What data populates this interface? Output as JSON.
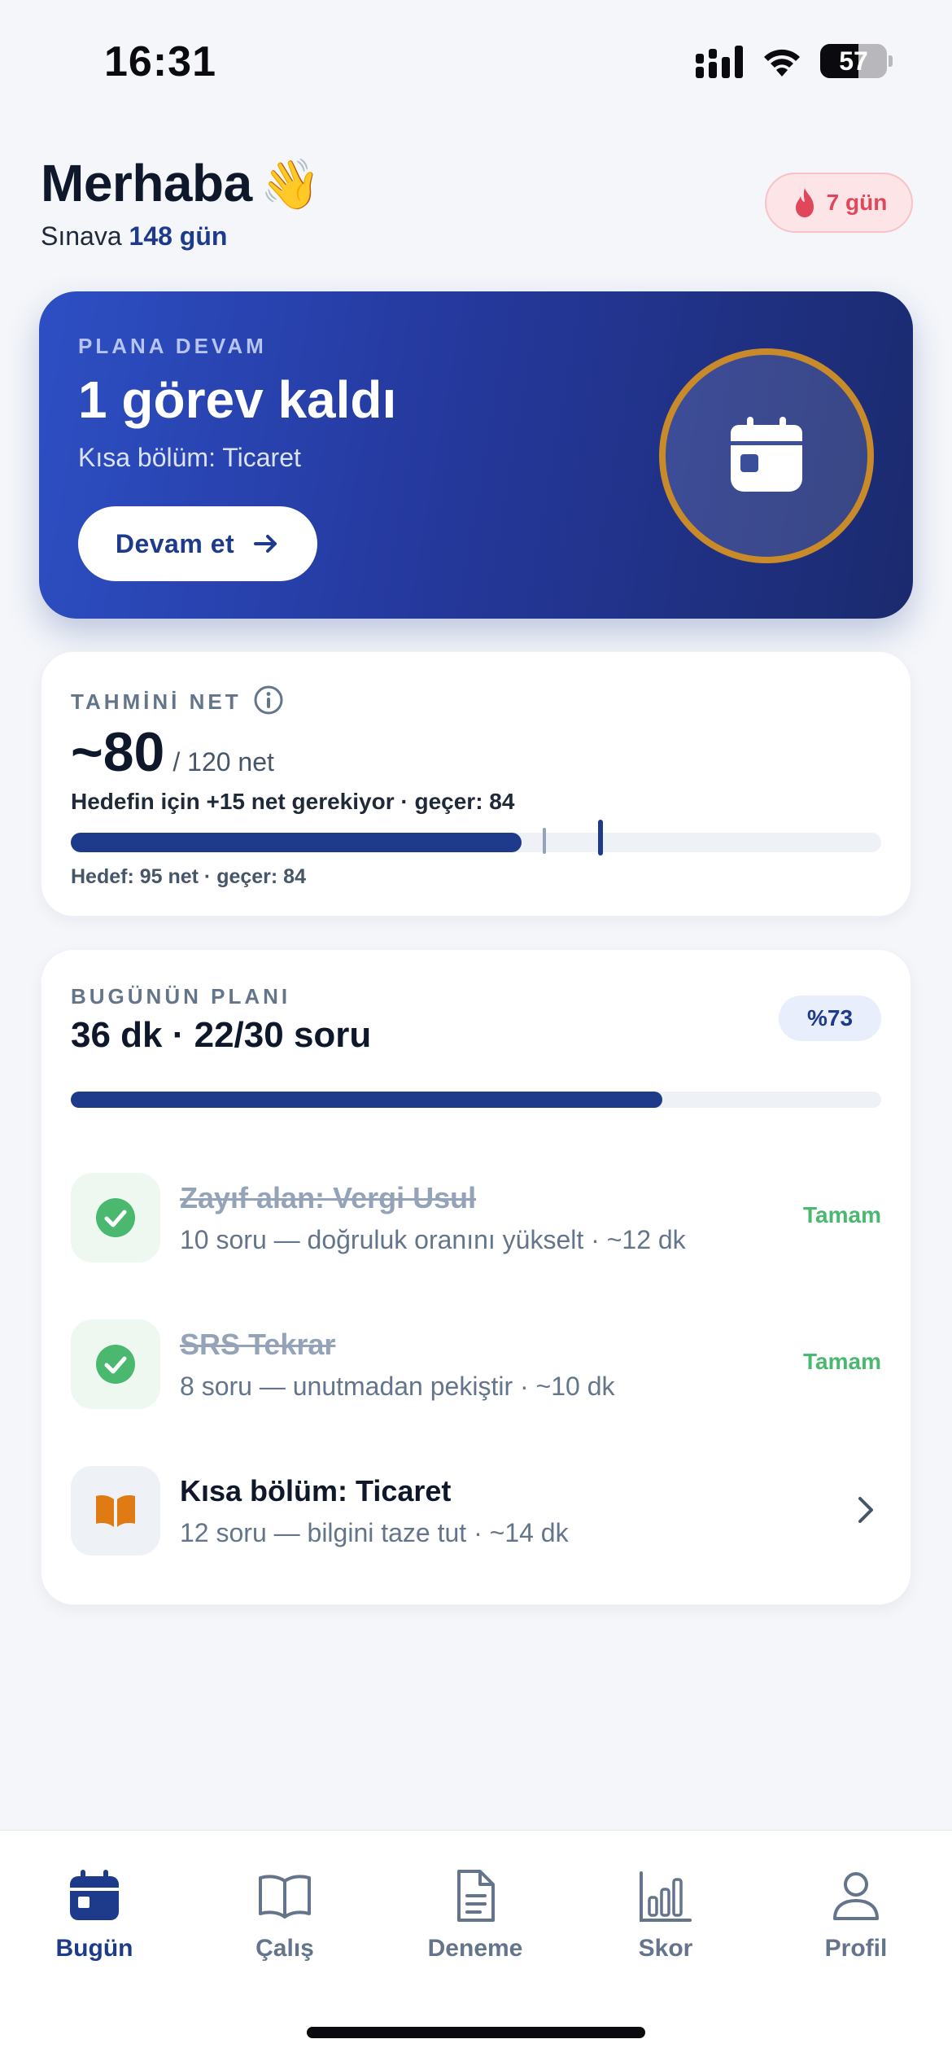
{
  "status_bar": {
    "time": "16:31",
    "battery": "57",
    "battery_level": 0.57
  },
  "header": {
    "greeting": "Merhaba",
    "greeting_emoji": "👋",
    "subtitle_prefix": "Sınava",
    "subtitle_days": "148 gün",
    "streak": "7 gün"
  },
  "hero": {
    "eyebrow": "PLANA DEVAM",
    "title": "1 görev kaldı",
    "subtitle": "Kısa bölüm: Ticaret",
    "button_label": "Devam et",
    "icon": "calendar-icon"
  },
  "net": {
    "eyebrow": "TAHMİNİ NET",
    "value": "~80",
    "total": "/ 120 net",
    "hint": "Hedefin için +15 net gerekiyor · geçer: 84",
    "footer": "Hedef: 95 net · geçer: 84",
    "current": 80,
    "max": 120,
    "pass_mark": 84,
    "goal": 95
  },
  "plan": {
    "eyebrow": "BUGÜNÜN PLANI",
    "title": "36 dk · 22/30 soru",
    "percent_label": "%73",
    "progress": 0.73,
    "tasks": [
      {
        "title": "Zayıf alan: Vergi Usul",
        "subtitle": "10 soru — doğruluk oranını yükselt · ~12 dk",
        "status": "Tamam",
        "icon": "check-circle-icon"
      },
      {
        "title": "SRS Tekrar",
        "subtitle": "8 soru — unutmadan pekiştir · ~10 dk",
        "status": "Tamam",
        "icon": "check-circle-icon"
      },
      {
        "title": "Kısa bölüm: Ticaret",
        "subtitle": "12 soru — bilgini taze tut · ~14 dk",
        "status": "",
        "icon": "book-open-icon"
      }
    ]
  },
  "colors": {
    "accent": "#1e3a8a",
    "success": "#4bb870",
    "streak": "#e0475a",
    "ring": "#c98a2a"
  },
  "tabs": [
    {
      "label": "Bugün",
      "icon": "calendar-icon",
      "active": true
    },
    {
      "label": "Çalış",
      "icon": "book-icon",
      "active": false
    },
    {
      "label": "Deneme",
      "icon": "document-icon",
      "active": false
    },
    {
      "label": "Skor",
      "icon": "bar-chart-icon",
      "active": false
    },
    {
      "label": "Profil",
      "icon": "user-icon",
      "active": false
    }
  ]
}
